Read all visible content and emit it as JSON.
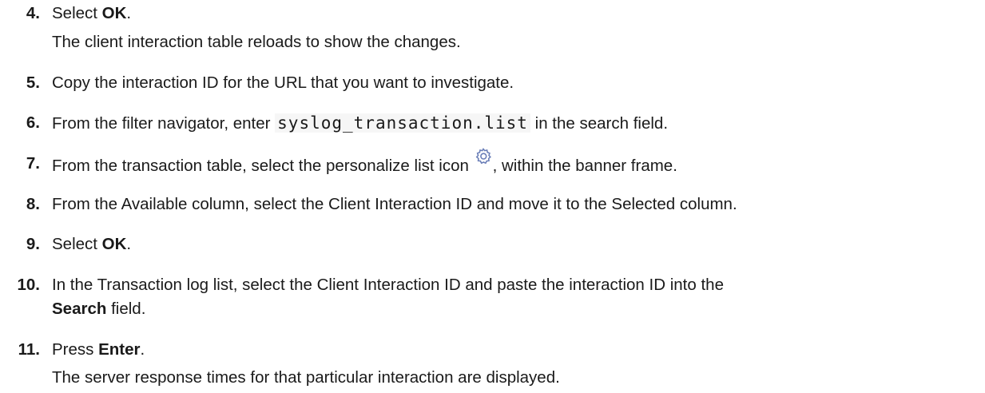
{
  "steps": [
    {
      "number": "4.",
      "pre": "Select ",
      "bold": "OK",
      "post": ".",
      "result": "The client interaction table reloads to show the changes."
    },
    {
      "number": "5.",
      "text": "Copy the interaction ID for the URL that you want to investigate."
    },
    {
      "number": "6.",
      "pre": "From the filter navigator, enter ",
      "code": "syslog_transaction.list",
      "post": " in the search field."
    },
    {
      "number": "7.",
      "pre": "From the transaction table, select the personalize list icon ",
      "icon": "gear-icon",
      "post": ", within the banner frame."
    },
    {
      "number": "8.",
      "text": "From the Available column, select the Client Interaction ID and move it to the Selected column."
    },
    {
      "number": "9.",
      "pre": "Select ",
      "bold": "OK",
      "post": "."
    },
    {
      "number": "10.",
      "pre": "In the Transaction log list, select the Client Interaction ID and paste the interaction ID into the",
      "bold": "Search",
      "post": " field."
    },
    {
      "number": "11.",
      "pre": "Press ",
      "bold": "Enter",
      "post": ".",
      "result": "The server response times for that particular interaction are displayed."
    }
  ],
  "colors": {
    "text": "#1a1a1a",
    "icon": "#6b7fb8",
    "code_bg": "#f6f6f6"
  }
}
